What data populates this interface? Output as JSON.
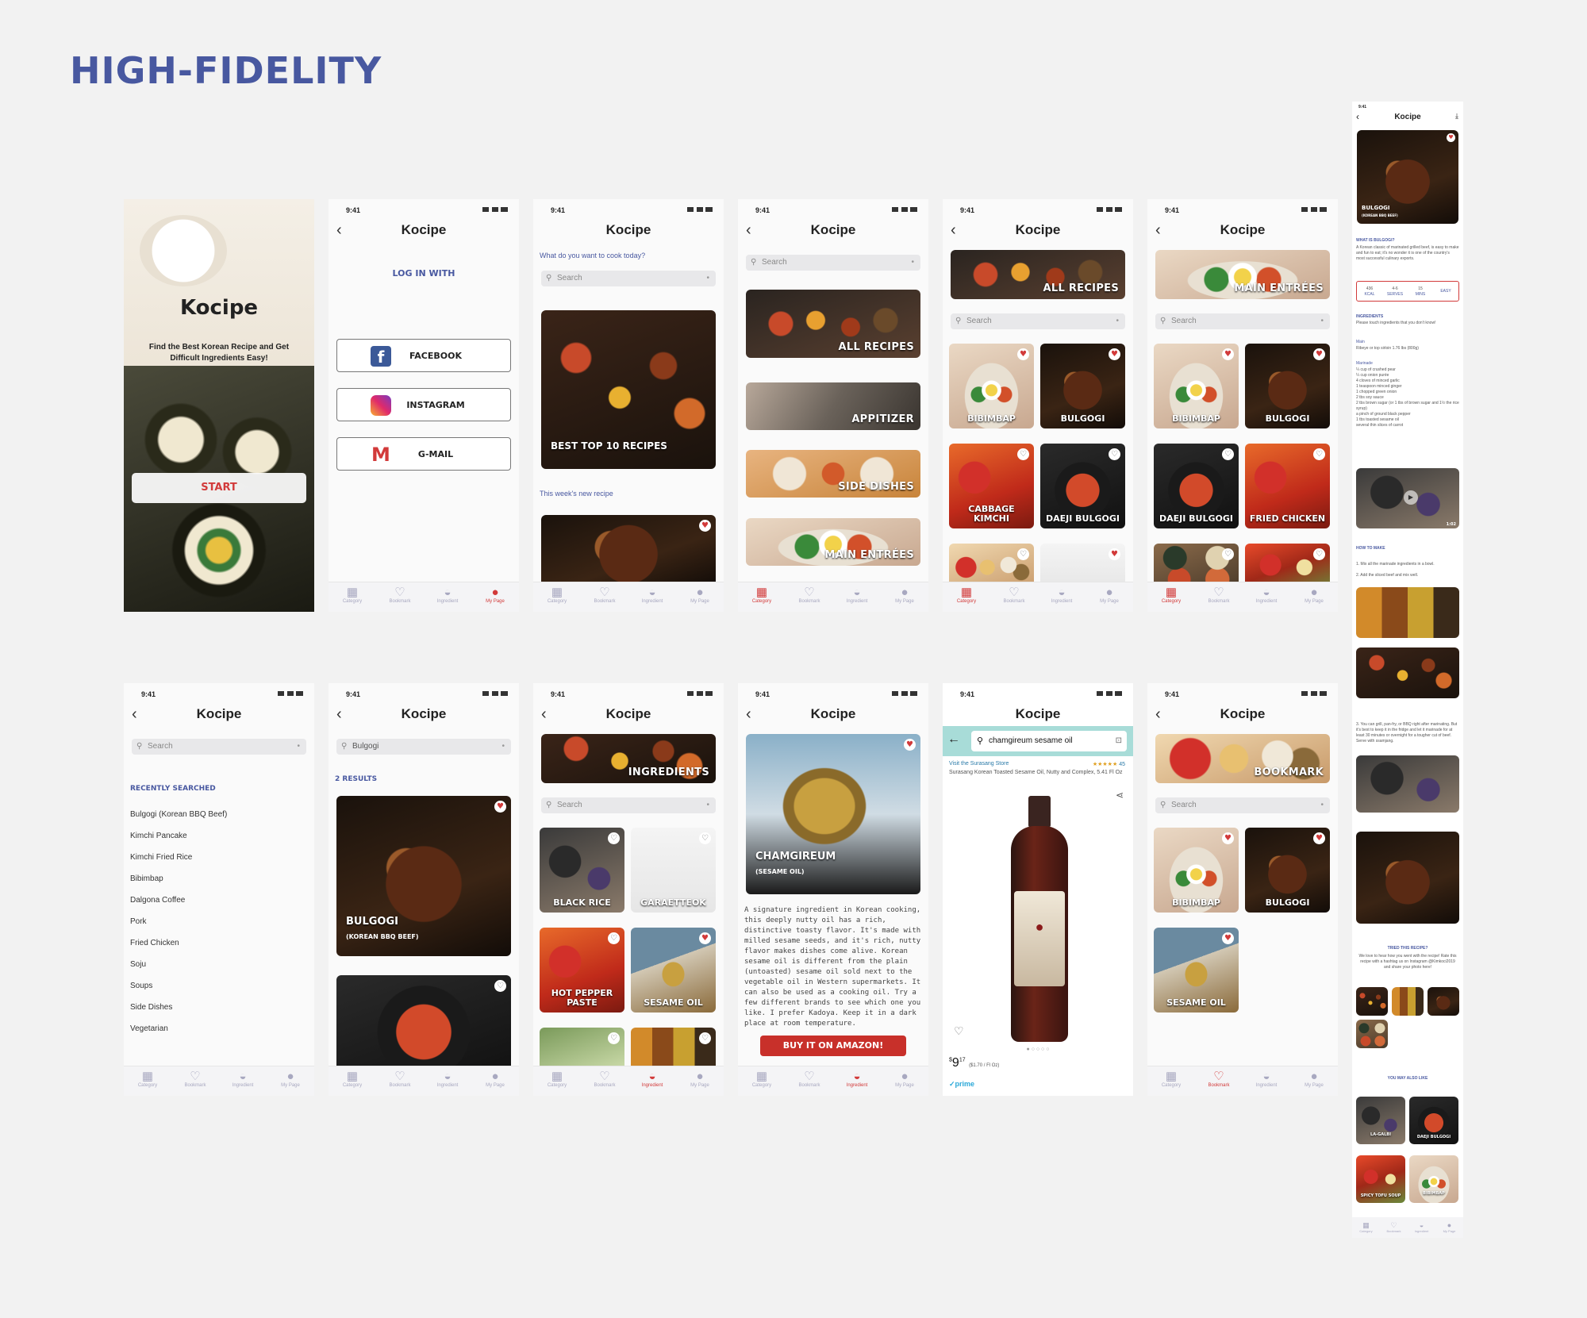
{
  "page": {
    "title": "HIGH-FIDELITY"
  },
  "app": {
    "name": "Kocipe",
    "time": "9:41"
  },
  "tabs": [
    "Category",
    "Bookmark",
    "Ingredient",
    "My Page"
  ],
  "splash": {
    "tagline": "Find the Best Korean Recipe and Get Difficult Ingredients Easy!",
    "start": "START"
  },
  "login": {
    "title": "LOG IN WITH",
    "facebook": "FACEBOOK",
    "instagram": "INSTAGRAM",
    "gmail": "G-MAIL"
  },
  "home": {
    "question": "What do you want to cook today?",
    "search": "Search",
    "best": "BEST TOP 10 RECIPES",
    "new_label": "This week's new recipe"
  },
  "category": {
    "search": "Search",
    "items": [
      "ALL RECIPES",
      "APPITIZER",
      "SIDE DISHES",
      "MAIN ENTRÉES"
    ]
  },
  "all_recipes": {
    "banner": "ALL RECIPES",
    "search": "Search",
    "items": [
      "BIBIMBAP",
      "BULGOGI",
      "CABBAGE KIMCHI",
      "DAEJI BULGOGI"
    ]
  },
  "main_entrees": {
    "banner": "MAIN ENTRÉES",
    "search": "Search",
    "items": [
      "BIBIMBAP",
      "BULGOGI",
      "DAEJI BULGOGI",
      "FRIED CHICKEN"
    ]
  },
  "detail": {
    "title": "BULGOGI",
    "subtitle": "(KOREAN BBQ BEEF)",
    "what_is": "WHAT IS BULGOGI?",
    "desc": "A Korean classic of marinated grilled beef, is easy to make and fun to eat; it's no wonder it is one of the country's most successful culinary exports.",
    "stats": [
      {
        "v": "436",
        "l": "KCAL"
      },
      {
        "v": "4-6",
        "l": "SERVES"
      },
      {
        "v": "15",
        "l": "MINS"
      },
      {
        "v": "",
        "l": "EASY"
      }
    ],
    "ingredients_h": "INGREDIENTS",
    "ingredients_note": "Please touch ingredients that you don't know!",
    "main_h": "Main",
    "main": "Ribeye or top sirloin 1.76 lbs (800g)",
    "marinade_h": "Marinade",
    "marinade": [
      "¼ cup of crushed pear",
      "¼ cup onion purée",
      "4 cloves of minced garlic",
      "1 teaspoon minced ginger",
      "1 chopped green onion",
      "2 tbs soy sauce",
      "2 tbs brown sugar (or 1 tbs of brown sugar and 1½ the rice syrup)",
      "a pinch of ground black pepper",
      "1 tbs toasted sesame oil",
      "several thin slices of carrot"
    ],
    "video_time": "1:02",
    "how_h": "HOW TO MAKE",
    "steps": [
      "1. Mix all the marinade ingredients in a bowl.",
      "2. Add the sliced beef and mix well.",
      "3. You can grill, pan-fry, or BBQ right after marinating. But it's best to keep it in the fridge and let it marinade for at least 30 minutes or overnight for a tougher cut of beef. Serve with ssamjang."
    ],
    "tried_h": "TRIED THIS RECIPE?",
    "tried": "We love to hear how you went with the recipe! Rate this recipe with a hashtag us on Instagram @Kimkoci2019 and share your photo here!",
    "also_h": "YOU MAY ALSO LIKE",
    "also": [
      "LA-GALBI",
      "DAEJI BULGOGI",
      "SPICY TOFU SOUP",
      "BIBIMBAP"
    ]
  },
  "recent": {
    "search": "Search",
    "heading": "RECENTLY SEARCHED",
    "items": [
      "Bulgogi (Korean BBQ Beef)",
      "Kimchi Pancake",
      "Kimchi Fried Rice",
      "Bibimbap",
      "Dalgona Coffee",
      "Pork",
      "Fried Chicken",
      "Soju",
      "Soups",
      "Side Dishes",
      "Vegetarian"
    ]
  },
  "results": {
    "query": "Bulgogi",
    "count": "2 RESULTS",
    "item_title": "BULGOGI",
    "item_sub": "(KOREAN BBQ BEEF)"
  },
  "ingredients": {
    "banner": "INGREDIENTS",
    "search": "Search",
    "items": [
      "BLACK RICE",
      "GARAETTEOK",
      "HOT PEPPER PASTE",
      "SESAME OIL"
    ]
  },
  "sesame": {
    "title": "CHAMGIREUM",
    "subtitle": "(SESAME OIL)",
    "desc": "A signature ingredient in Korean cooking, this deeply nutty oil has a rich, distinctive toasty flavor. It's made with milled sesame seeds, and it's rich, nutty flavor makes dishes come alive. Korean sesame oil is different from the plain (untoasted) sesame oil sold next to the vegetable oil in Western supermarkets. It can also be used as a cooking oil. Try a few different brands to see which one you like. I prefer Kadoya. Keep it in a dark place at room temperature.",
    "buy": "BUY IT ON AMAZON!"
  },
  "amazon": {
    "query": "chamgireum sesame oil",
    "store": "Visit the Surasang Store",
    "stars": "★★★★★",
    "reviews": "45",
    "product": "Surasang Korean Toasted Sesame Oil, Nutty and Complex, 5.41 Fl Oz",
    "price_sym": "$",
    "price_main": "9",
    "price_frac": "17",
    "unit_price": "($1.70 / Fl Oz)",
    "prime": "✓prime"
  },
  "bookmark": {
    "banner": "BOOKMARK",
    "search": "Search",
    "items": [
      "BIBIMBAP",
      "BULGOGI",
      "SESAME OIL"
    ]
  }
}
